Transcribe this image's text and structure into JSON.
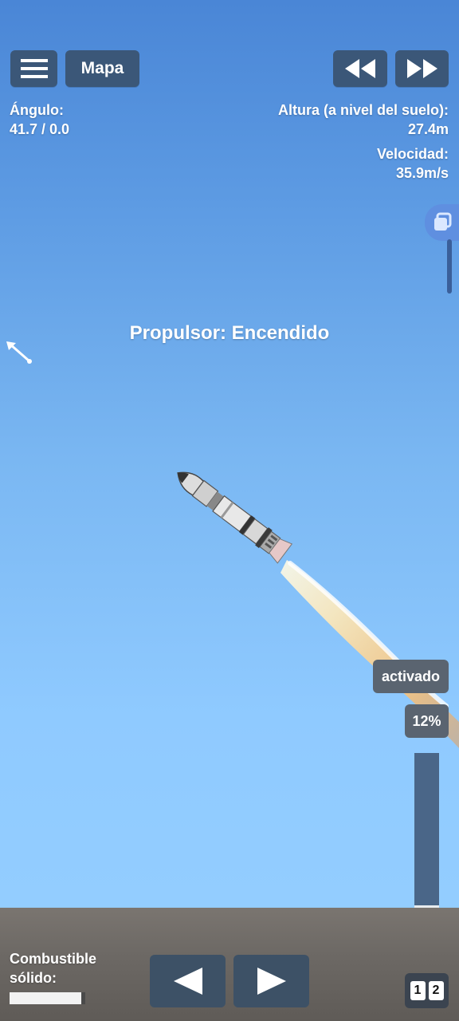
{
  "top_bar": {
    "map_label": "Mapa"
  },
  "telemetry": {
    "angle_label": "Ángulo:",
    "angle_value": "41.7 / 0.0",
    "altitude_label": "Altura (a nivel del suelo):",
    "altitude_value": "27.4m",
    "velocity_label": "Velocidad:",
    "velocity_value": "35.9m/s"
  },
  "status_message": "Propulsor: Encendido",
  "throttle": {
    "state_label": "activado",
    "percent_label": "12%",
    "level": 0.12
  },
  "fuel": {
    "label_line1": "Combustible",
    "label_line2": "sólido:",
    "level": 0.95
  },
  "stage_labels": [
    "1",
    "2"
  ],
  "colors": {
    "button_bg": "#3b5778",
    "ground": "#6d6965",
    "sky_top": "#4a86d6",
    "sky_bottom": "#93cdff"
  }
}
